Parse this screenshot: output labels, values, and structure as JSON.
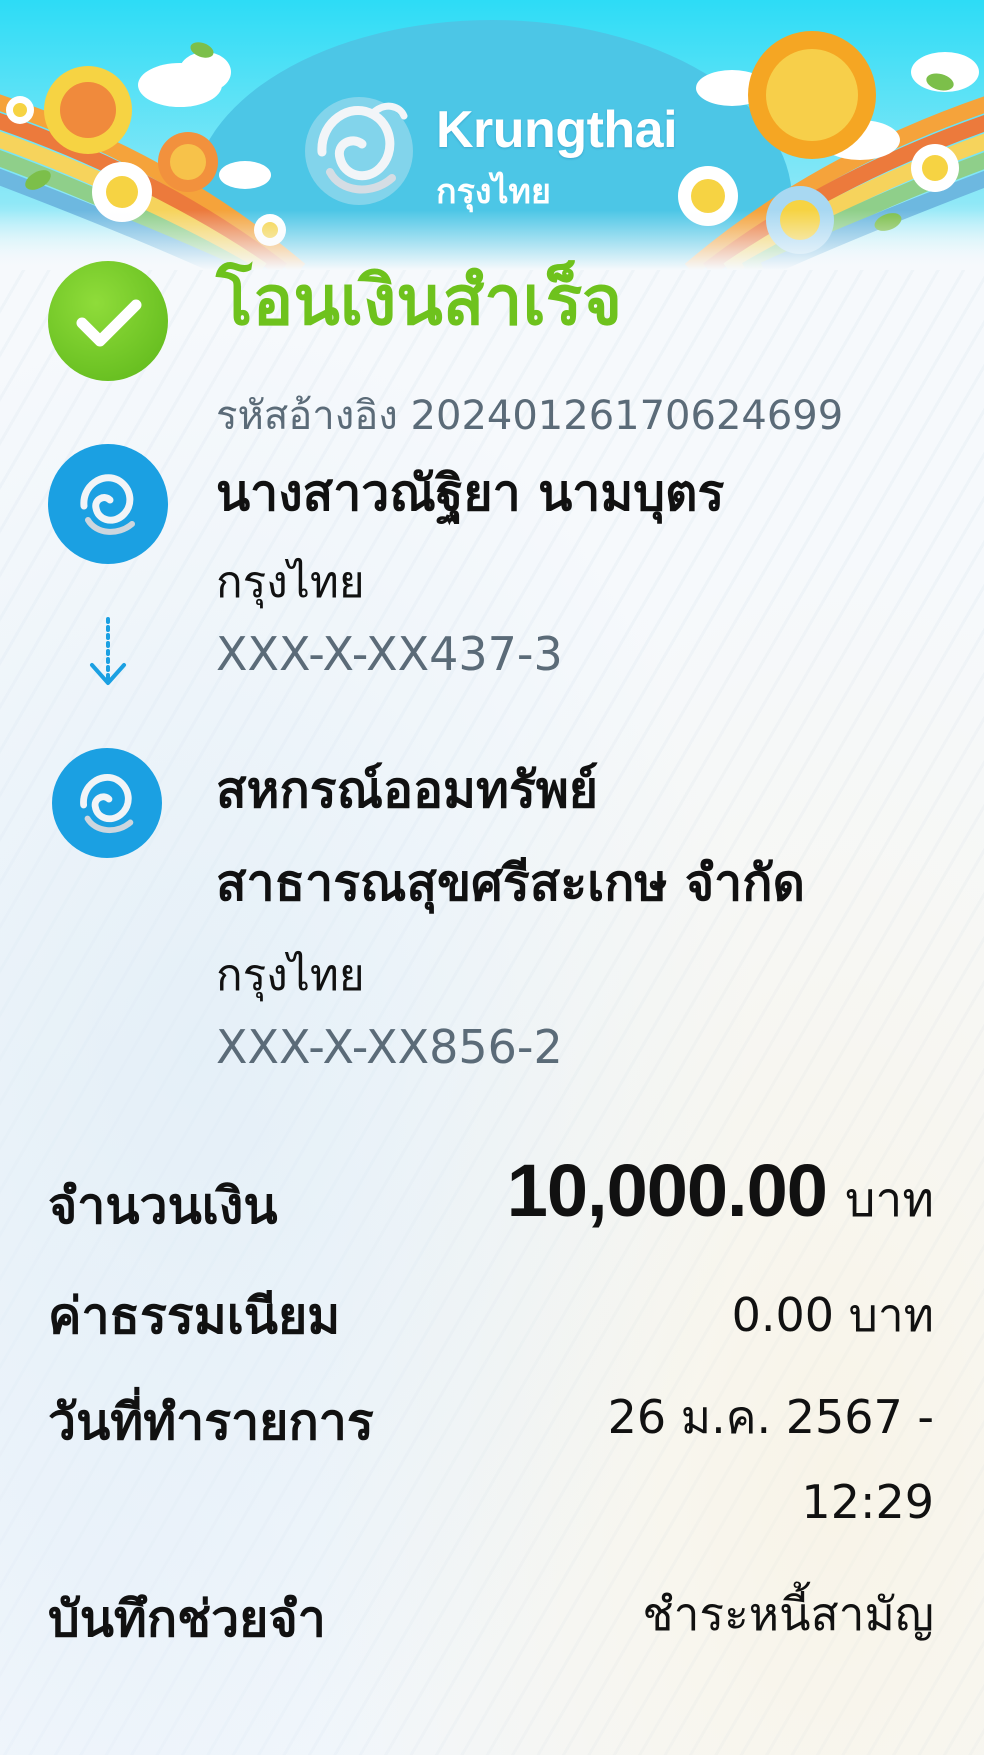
{
  "header": {
    "brand_name": "Krungthai",
    "brand_thai": "กรุงไทย"
  },
  "status": {
    "title": "โอนเงินสำเร็จ",
    "reference": "รหัสอ้างอิง 20240126170624699"
  },
  "sender": {
    "name": "นางสาวณัฐิยา นามบุตร",
    "bank": "กรุงไทย",
    "account": "XXX-X-XX437-3"
  },
  "receiver": {
    "name_line1": "สหกรณ์ออมทรัพย์",
    "name_line2": "สาธารณสุขศรีสะเกษ จำกัด",
    "bank": "กรุงไทย",
    "account": "XXX-X-XX856-2"
  },
  "details": {
    "amount_label": "จำนวนเงิน",
    "amount_value": "10,000.00",
    "amount_unit": "บาท",
    "fee_label": "ค่าธรรมเนียม",
    "fee_value": "0.00 บาท",
    "date_label": "วันที่ทำรายการ",
    "date_value_line1": "26 ม.ค. 2567 -",
    "date_value_line2": "12:29",
    "memo_label": "บันทึกช่วยจำ",
    "memo_value": "ชำระหนี้สามัญ"
  },
  "colors": {
    "success": "#6ec21d",
    "brand_blue": "#1ba0e2",
    "muted_text": "#5b6b78"
  }
}
